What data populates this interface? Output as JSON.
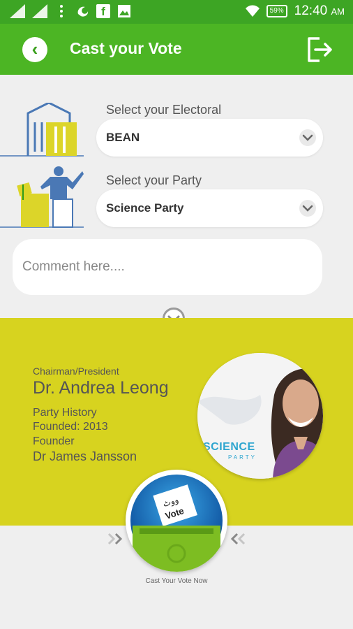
{
  "status_bar": {
    "time": "12:40",
    "am_pm": "AM",
    "battery": "59%",
    "facebook_glyph": "f",
    "icons": [
      "signal-icon",
      "signal-icon",
      "menu-dots-icon",
      "uc-browser-icon",
      "facebook-icon",
      "gallery-icon",
      "wifi-icon",
      "battery-icon"
    ]
  },
  "header": {
    "title": "Cast your Vote",
    "back_icon": "chevron-left-icon",
    "back_glyph": "‹",
    "logout_icon": "logout-icon"
  },
  "form": {
    "electoral_label": "Select your Electoral",
    "electoral_value": "BEAN",
    "party_label": "Select your Party",
    "party_value": "Science Party",
    "comment_placeholder": "Comment here...."
  },
  "party_info": {
    "chairman_label": "Chairman/President",
    "chairman_name": "Dr. Andrea Leong",
    "history_label": "Party History",
    "founded": "Founded: 2013",
    "founder_label": "Founder",
    "founder_name": "Dr James Jansson",
    "logo_text": "SCIENCE",
    "logo_subtext": "PARTY"
  },
  "vote": {
    "caption": "Cast Your Vote Now",
    "ballot_text": "Vote",
    "ballot_urdu": "ووٹ"
  },
  "colors": {
    "status_bar": "#3da524",
    "app_bar": "#4cb524",
    "panel_yellow": "#d7d31f",
    "accent_blue": "#2ea5cf"
  }
}
